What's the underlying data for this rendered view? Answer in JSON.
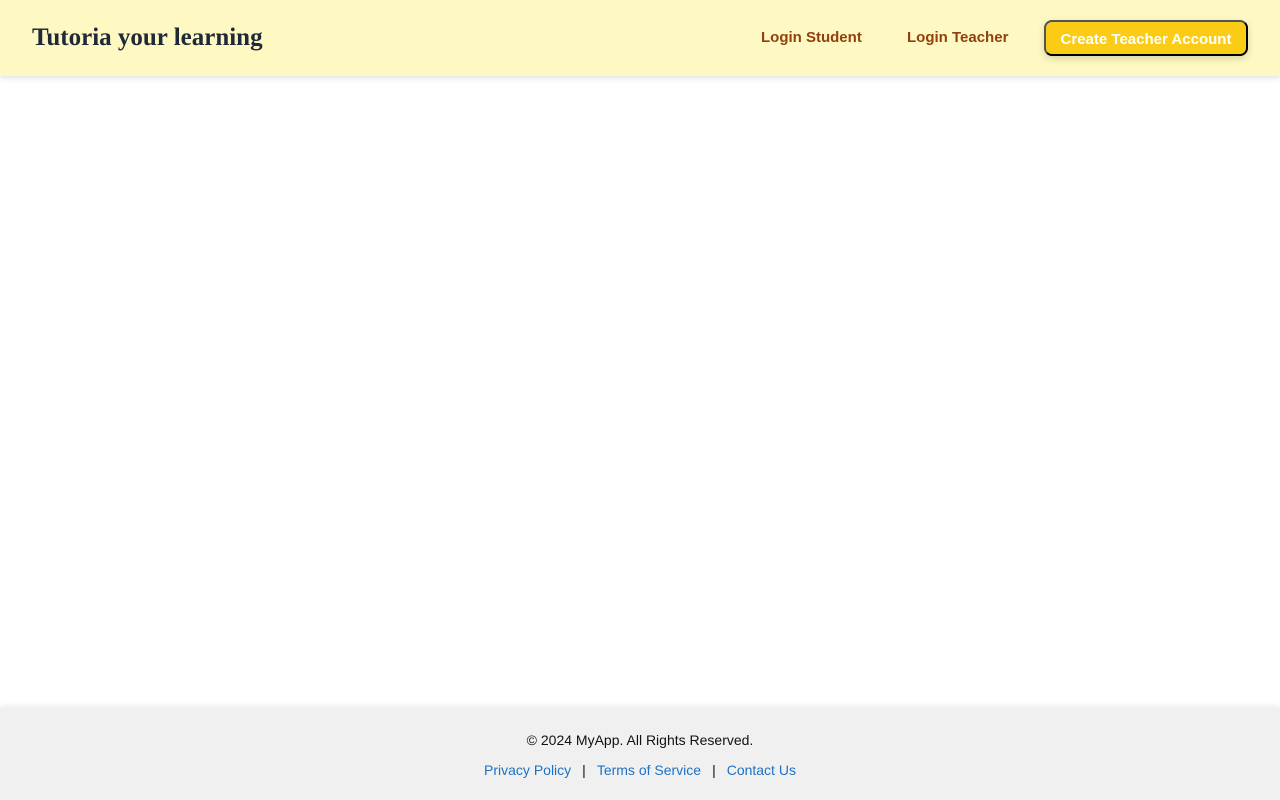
{
  "header": {
    "brand": "Tutoria your learning",
    "nav": {
      "login_student": "Login Student",
      "login_teacher": "Login Teacher",
      "create_teacher_account": "Create Teacher Account"
    }
  },
  "footer": {
    "copyright": "© 2024 MyApp. All Rights Reserved.",
    "links": {
      "privacy": "Privacy Policy",
      "terms": "Terms of Service",
      "contact": "Contact Us"
    },
    "separator": "|"
  },
  "colors": {
    "header_bg": "#fef9c3",
    "accent": "#facc15",
    "nav_text": "#92400e",
    "link": "#1d72c4",
    "footer_bg": "#f0f0f0"
  }
}
